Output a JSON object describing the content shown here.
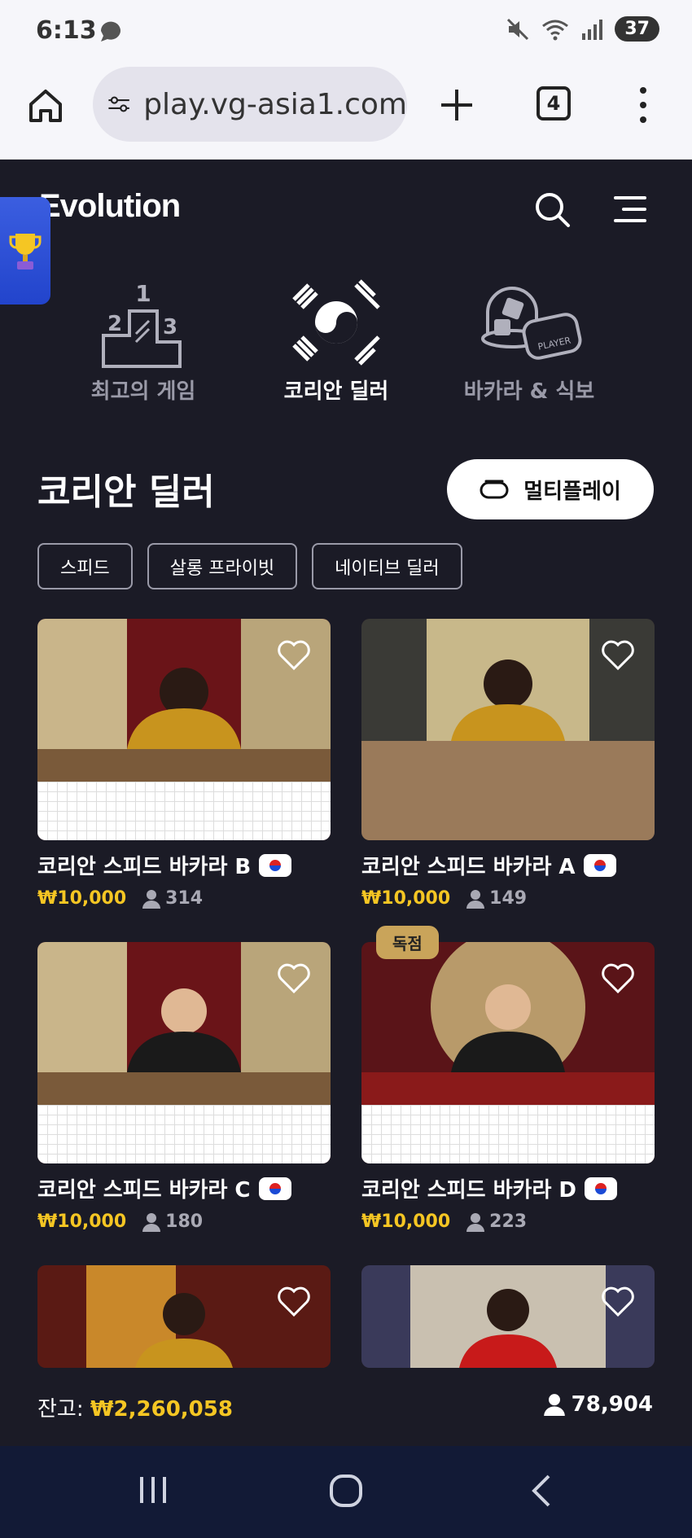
{
  "status": {
    "time": "6:13",
    "battery": "37"
  },
  "browser": {
    "url": "play.vg-asia1.com",
    "tab_count": "4"
  },
  "app": {
    "logo": "Evolution"
  },
  "categories": [
    {
      "label": "최고의 게임",
      "icon": "podium-icon"
    },
    {
      "label": "코리안 딜러",
      "icon": "taegeuk-icon"
    },
    {
      "label": "바카라 & 식보",
      "icon": "dice-icon"
    }
  ],
  "section": {
    "title": "코리안 딜러",
    "multiplay_label": "멀티플레이"
  },
  "filters": [
    "스피드",
    "살롱 프라이빗",
    "네이티브 딜러"
  ],
  "games": [
    {
      "title": "코리안 스피드 바카라 B",
      "price": "₩10,000",
      "players": "314"
    },
    {
      "title": "코리안 스피드 바카라 A",
      "price": "₩10,000",
      "players": "149"
    },
    {
      "title": "코리안 스피드 바카라 C",
      "price": "₩10,000",
      "players": "180"
    },
    {
      "title": "코리안 스피드 바카라 D",
      "price": "₩10,000",
      "players": "223",
      "badge": "독점"
    }
  ],
  "footer": {
    "balance_label": "잔고:",
    "balance_value": "₩2,260,058",
    "online_count": "78,904"
  },
  "colors": {
    "accent": "#f5c623",
    "background": "#1b1b26",
    "navbar": "#121a36"
  }
}
